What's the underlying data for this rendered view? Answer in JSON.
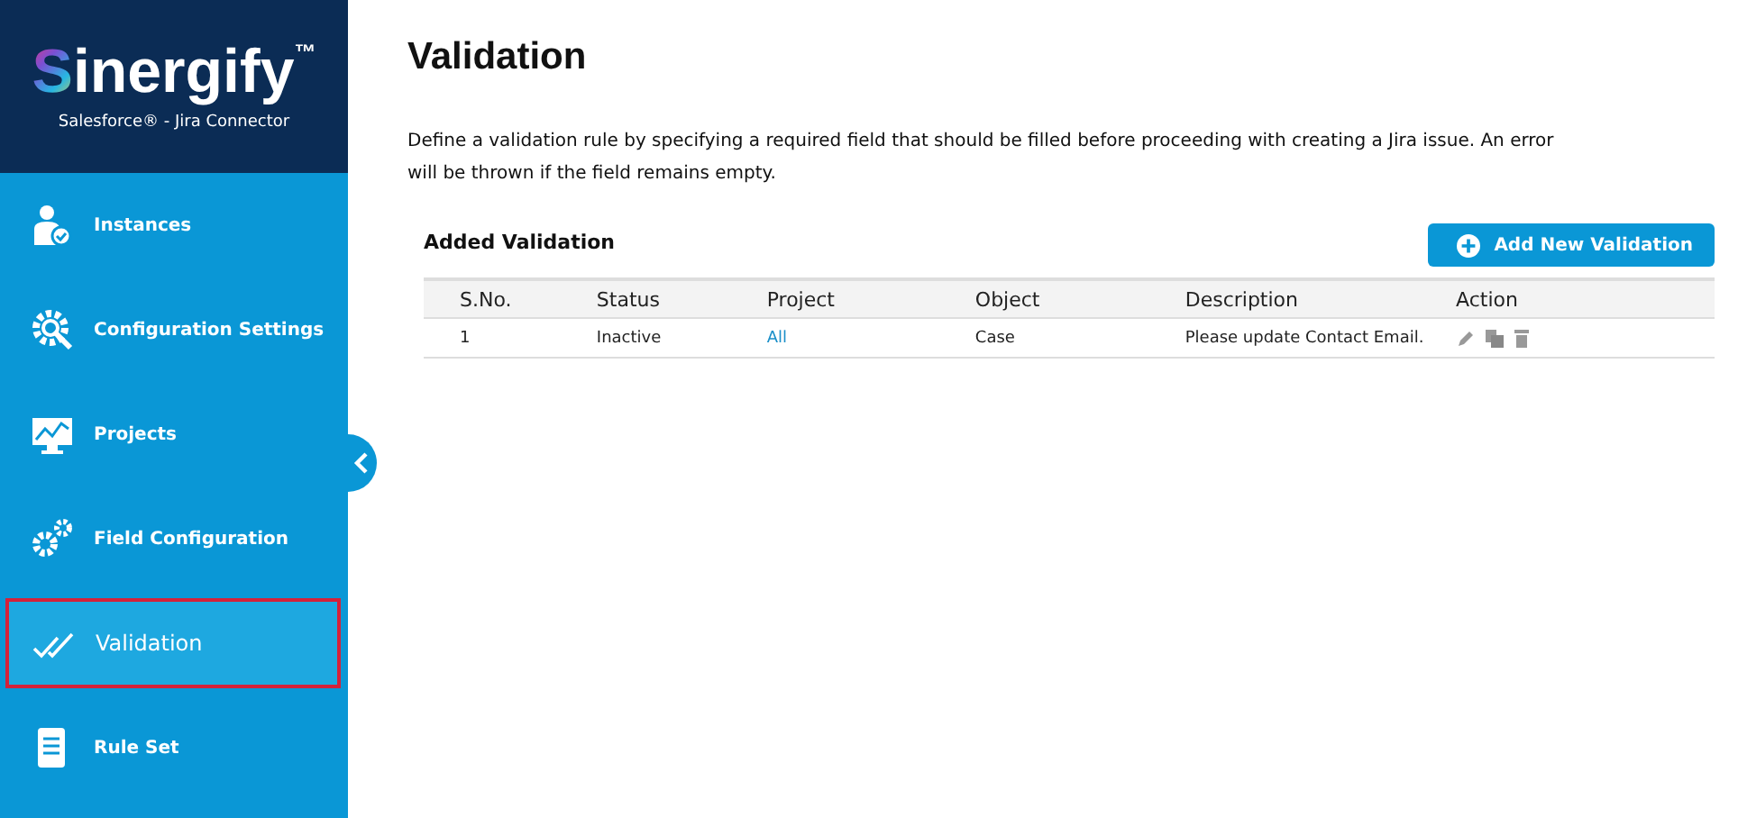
{
  "brand": {
    "name": "Sinergify",
    "trademark": "™",
    "tagline": "Salesforce® - Jira Connector"
  },
  "sidebar": {
    "items": [
      {
        "label": "Instances",
        "selected": false
      },
      {
        "label": "Configuration Settings",
        "selected": false
      },
      {
        "label": "Projects",
        "selected": false
      },
      {
        "label": "Field Configuration",
        "selected": false
      },
      {
        "label": "Validation",
        "selected": true
      },
      {
        "label": "Rule Set",
        "selected": false
      }
    ]
  },
  "page": {
    "title": "Validation",
    "description": "Define a validation rule by specifying a required field that should be filled before proceeding with creating a Jira issue. An error will be thrown if the field remains empty."
  },
  "section": {
    "title": "Added Validation",
    "add_button": "Add New Validation"
  },
  "table": {
    "columns": [
      "S.No.",
      "Status",
      "Project",
      "Object",
      "Description",
      "Action"
    ],
    "rows": [
      {
        "number": "1",
        "status": "Inactive",
        "project": "All",
        "object": "Case",
        "description": "Please update Contact Email."
      }
    ]
  }
}
